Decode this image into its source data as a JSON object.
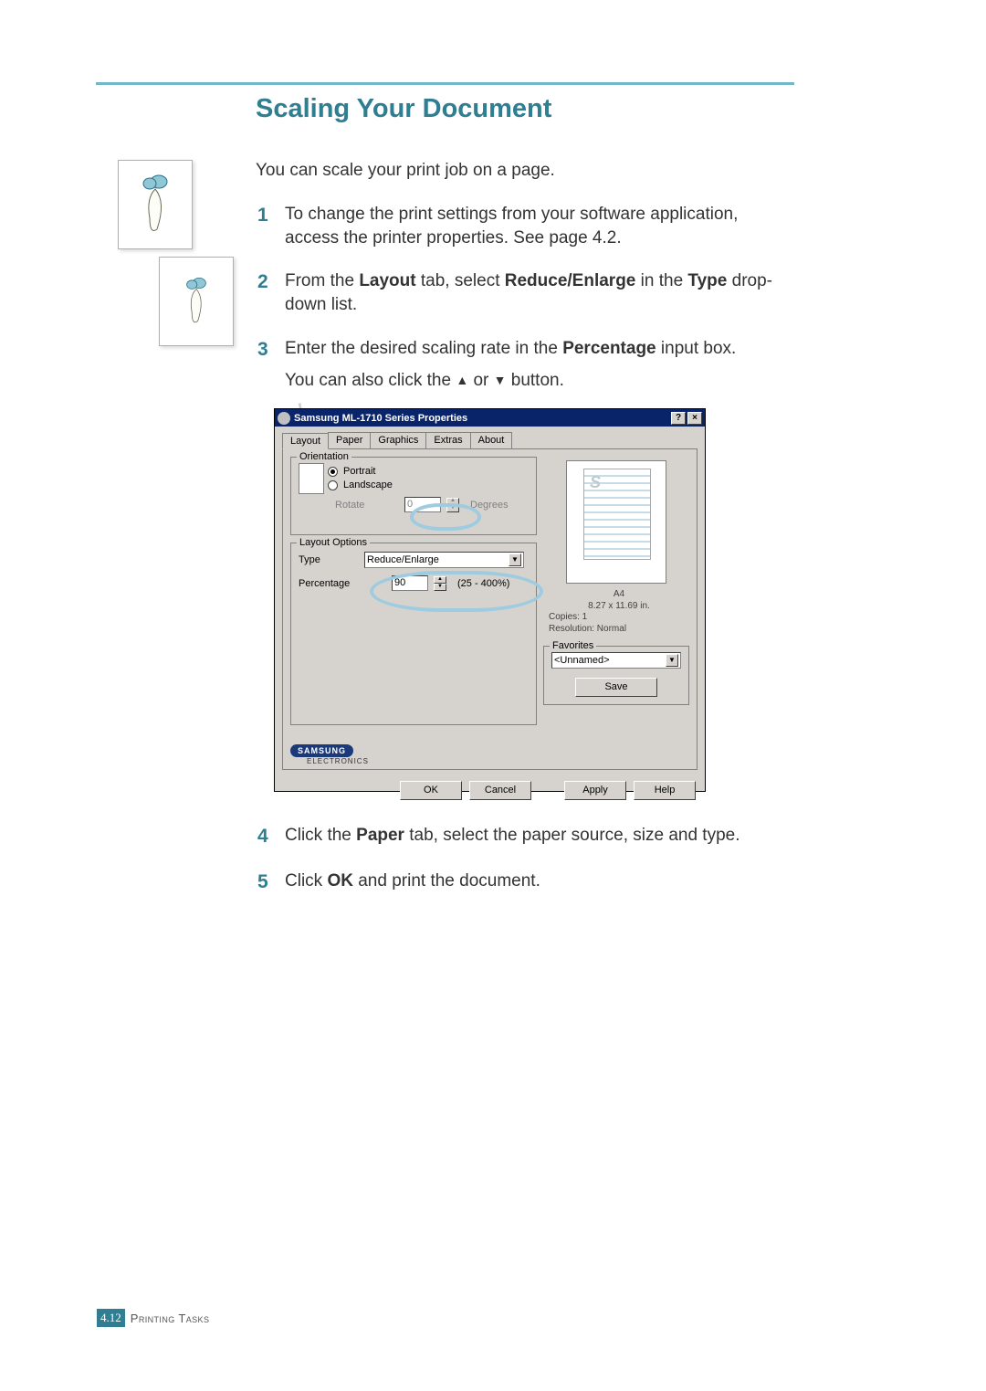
{
  "title": "Scaling Your Document",
  "intro": "You can scale your print job on a page.",
  "steps": {
    "s1_a": "To change the print settings from your software application, access the printer properties. See page 4.2.",
    "s2_pre": "From the ",
    "s2_b1": "Layout",
    "s2_mid": " tab, select ",
    "s2_b2": "Reduce/Enlarge",
    "s2_mid2": " in the ",
    "s2_b3": "Type",
    "s2_post": " drop-down list.",
    "s3_pre": "Enter the desired scaling rate in the ",
    "s3_b1": "Percentage",
    "s3_post": " input box.",
    "s3_sub_pre": "You can also click the ",
    "s3_sub_mid": " or ",
    "s3_sub_post": " button.",
    "s4_pre": "Click the ",
    "s4_b1": "Paper",
    "s4_post": " tab, select the paper source, size and type.",
    "s5_pre": "Click ",
    "s5_b1": "OK",
    "s5_post": " and print the document."
  },
  "step_nums": {
    "n1": "1",
    "n2": "2",
    "n3": "3",
    "n4": "4",
    "n5": "5"
  },
  "dialog": {
    "title": "Samsung ML-1710 Series Properties",
    "help_btn": "?",
    "close_btn": "×",
    "tabs": {
      "layout": "Layout",
      "paper": "Paper",
      "graphics": "Graphics",
      "extras": "Extras",
      "about": "About"
    },
    "orientation": {
      "group": "Orientation",
      "portrait": "Portrait",
      "landscape": "Landscape",
      "rotate": "Rotate",
      "rotate_val": "0",
      "degrees": "Degrees"
    },
    "layout_opts": {
      "group": "Layout Options",
      "type_label": "Type",
      "type_value": "Reduce/Enlarge",
      "pct_label": "Percentage",
      "pct_value": "90",
      "pct_range": "(25 - 400%)"
    },
    "preview": {
      "papersize": "A4",
      "dims": "8.27 x 11.69 in.",
      "copies": "Copies: 1",
      "resolution": "Resolution: Normal"
    },
    "favorites": {
      "group": "Favorites",
      "value": "<Unnamed>",
      "save": "Save"
    },
    "brand": {
      "name": "SAMSUNG",
      "sub": "ELECTRONICS"
    },
    "buttons": {
      "ok": "OK",
      "cancel": "Cancel",
      "apply": "Apply",
      "help": "Help"
    }
  },
  "footer": {
    "badge_prefix": "4.",
    "badge_num": "12",
    "section": "Printing Tasks"
  },
  "glyph": {
    "up": "▲",
    "down": "▼"
  }
}
